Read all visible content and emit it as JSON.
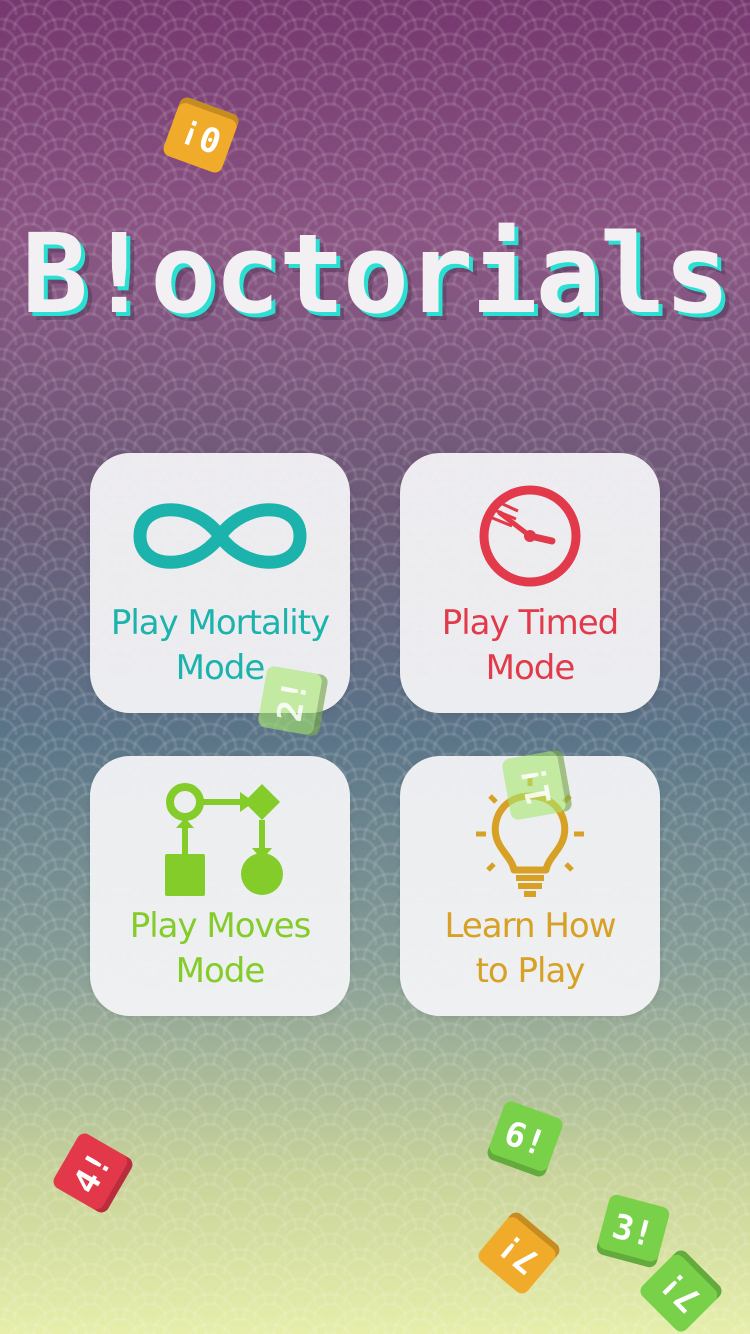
{
  "app": {
    "title": "B!octorials"
  },
  "menu": {
    "mortality": {
      "line1": "Play Mortality",
      "line2": "Mode",
      "icon": "infinity-icon",
      "color": "#1cb3ad"
    },
    "timed": {
      "line1": "Play Timed",
      "line2": "Mode",
      "icon": "clock-icon",
      "color": "#e23a4a"
    },
    "moves": {
      "line1": "Play Moves",
      "line2": "Mode",
      "icon": "flowchart-icon",
      "color": "#84cc2a"
    },
    "learn": {
      "line1": "Learn How",
      "line2": "to Play",
      "icon": "lightbulb-icon",
      "color": "#d6a124"
    }
  },
  "blocks": [
    {
      "text": "0!",
      "color": "#f1ab2a"
    },
    {
      "text": "2!",
      "color": "#a8e86e"
    },
    {
      "text": "1!",
      "color": "#a8e86e"
    },
    {
      "text": "4!",
      "color": "#e2384a"
    },
    {
      "text": "6!",
      "color": "#79d14a"
    },
    {
      "text": "7!",
      "color": "#f1ab2a"
    },
    {
      "text": "3!",
      "color": "#79d14a"
    },
    {
      "text": "7!",
      "color": "#79d14a"
    }
  ]
}
